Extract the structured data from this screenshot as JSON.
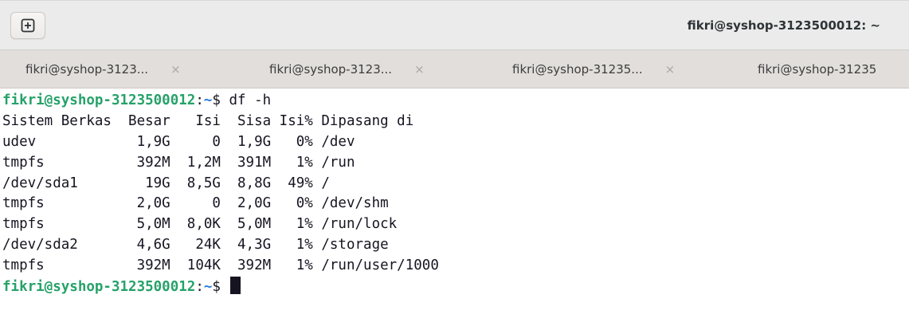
{
  "window": {
    "title": "fikri@syshop-3123500012: ~",
    "new_tab_icon": "plus-box-icon"
  },
  "tabs": [
    {
      "label": "fikri@syshop-3123...",
      "close": "×"
    },
    {
      "label": "fikri@syshop-3123...",
      "close": "×"
    },
    {
      "label": "fikri@syshop-31235...",
      "close": "×"
    },
    {
      "label": "fikri@syshop-31235",
      "close": ""
    }
  ],
  "terminal": {
    "prompt_user": "fikri@syshop-3123500012",
    "prompt_sep": ":",
    "prompt_path": "~",
    "prompt_symbol": "$ ",
    "command": "df -h",
    "output_lines": [
      "Sistem Berkas  Besar   Isi  Sisa Isi% Dipasang di",
      "udev            1,9G     0  1,9G   0% /dev",
      "tmpfs           392M  1,2M  391M   1% /run",
      "/dev/sda1        19G  8,5G  8,8G  49% /",
      "tmpfs           2,0G     0  2,0G   0% /dev/shm",
      "tmpfs           5,0M  8,0K  5,0M   1% /run/lock",
      "/dev/sda2       4,6G   24K  4,3G   1% /storage",
      "tmpfs           392M  104K  392M   1% /run/user/1000"
    ]
  },
  "colors": {
    "prompt_user": "#26a269",
    "prompt_path": "#2a7bde",
    "text": "#171421",
    "background": "#ffffff"
  }
}
